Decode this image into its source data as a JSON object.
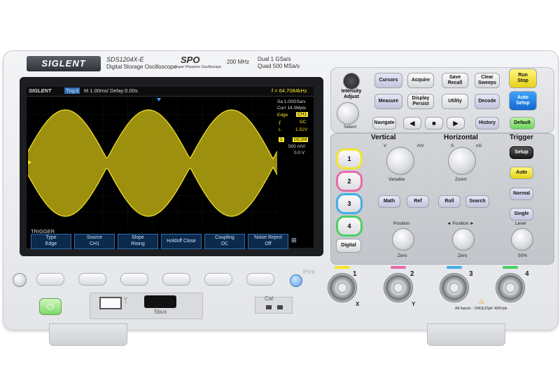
{
  "brand": {
    "logo": "SIGLENT",
    "model": "SDS1204X-E",
    "subtitle": "Digital Storage Oscilloscope",
    "spo_logo": "SPO",
    "spo_caption": "Super Phosphor Oscilloscope",
    "bandwidth": "200 MHz",
    "dual_rate": "Dual 1 GSa/s",
    "quad_rate": "Quad 500 MSa/s"
  },
  "screen": {
    "logo": "SIGLENT",
    "status": "Trig'd",
    "timebase": "M 1.00ms/ Delay:0.00s",
    "frequency": "f = 64.7084kHz",
    "sample_rate": "Sa 1.00GSa/s",
    "memory": "Curr 14.0Mpts",
    "trigger_type": "Edge",
    "trigger_source": "CH1",
    "trigger_coupling": "DC",
    "trigger_level_label": "L",
    "trigger_level": "1.51V",
    "ch_number": "1",
    "ch_coupling": "DC1M",
    "ch_scale": "500 mV/",
    "ch_offset": "0.0 V",
    "menu_title": "TRIGGER",
    "menu": [
      {
        "label": "Type",
        "value": "Edge"
      },
      {
        "label": "Source",
        "value": "CH1"
      },
      {
        "label": "Slope",
        "value": "Rising"
      },
      {
        "label": "Holdoff Close",
        "value": ""
      },
      {
        "label": "Coupling",
        "value": "DC"
      },
      {
        "label": "Noise Reject",
        "value": "Off"
      }
    ],
    "trace_color": "#f5e42a"
  },
  "controls": {
    "intensity": "Intensity\nAdjust",
    "select": "Select",
    "keys_top": [
      "Cursors",
      "Acquire",
      "Save\nRecall",
      "Clear\nSweeps",
      "Run\nStop",
      "Measure",
      "Display\nPersist",
      "Utility",
      "Decode",
      "Auto\nSetup"
    ],
    "navigate": "Navigate",
    "history": "History",
    "default": "Default",
    "vertical_title": "Vertical",
    "horizontal_title": "Horizontal",
    "trigger_title": "Trigger",
    "channels": [
      "1",
      "2",
      "3",
      "4"
    ],
    "channel_colors": [
      "#f5e42a",
      "#e86aa8",
      "#42aee8",
      "#4ccf62"
    ],
    "digital": "Digital",
    "variable": "Variable",
    "zoom": "Zoom",
    "v_lbl": "V",
    "mv_lbl": "mV",
    "s_lbl": "S",
    "ns_lbl": "nS",
    "math": "Math",
    "ref": "Ref",
    "roll": "Roll",
    "search": "Search",
    "setup": "Setup",
    "auto": "Auto",
    "normal": "Normal",
    "single": "Single",
    "level": "Level",
    "position": "Position",
    "h_position": "◄ Position ►",
    "zero": "Zero",
    "fifty": "50%",
    "print": "Print",
    "inputs_note": "All Inputs : 1MΩ||15pF 400Vpk",
    "bnc_labels": [
      "1",
      "2",
      "3",
      "4"
    ],
    "bnc_xy": [
      "X",
      "Y"
    ],
    "port_label": "Cal",
    "hdmi_label": "Sbus"
  }
}
